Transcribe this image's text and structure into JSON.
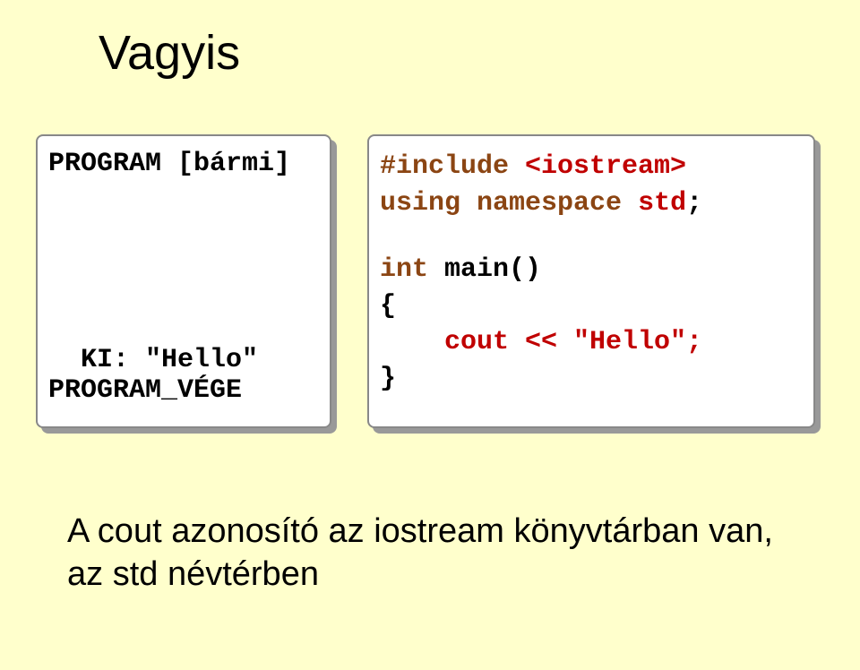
{
  "title": "Vagyis",
  "left": {
    "line1": "PROGRAM [bármi]",
    "line2": "  KI: \"Hello\"",
    "line3": "PROGRAM_VÉGE"
  },
  "right": {
    "include_kw": "#include",
    "iostream": " <iostream>",
    "using_kw": "using",
    "namespace_kw": " namespace ",
    "std": "std",
    "semi1": ";",
    "int_kw": "int",
    "main": " main()",
    "brace_open": "{",
    "cout": "    cout << \"Hello\";",
    "brace_close": "}"
  },
  "caption": {
    "line1": "A cout azonosító az iostream könyvtárban van,",
    "line2": "az std névtérben"
  }
}
